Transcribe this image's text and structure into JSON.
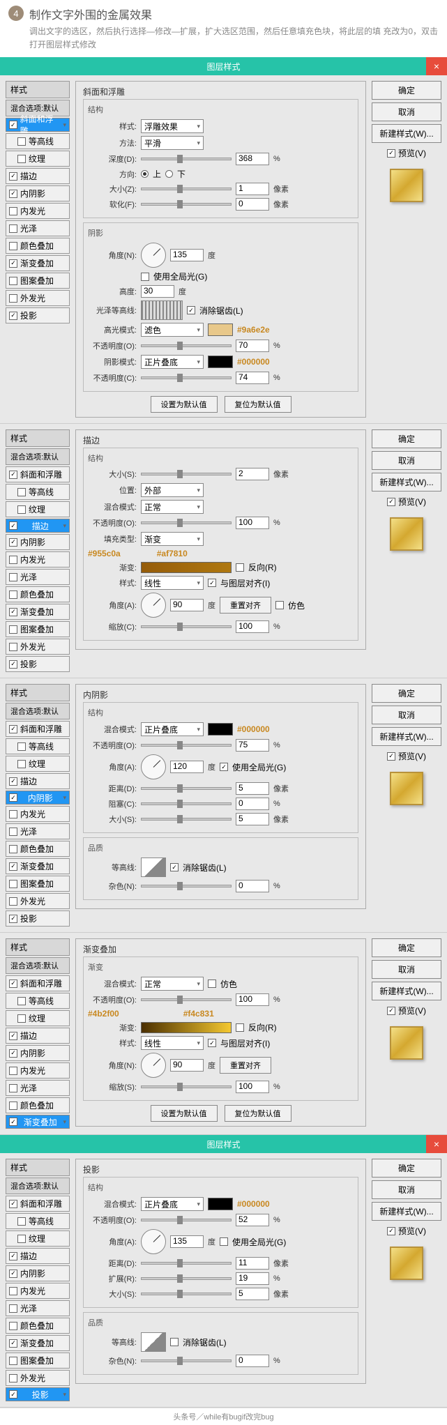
{
  "header": {
    "step": "4",
    "title": "制作文字外围的金属效果",
    "desc": "调出文字的选区，然后执行选择—修改—扩展，扩大选区范围，然后任意填充色块，将此层的填 充改为0，双击打开图层样式修改"
  },
  "titlebar": "图层样式",
  "close": "×",
  "stylesHeader": "样式",
  "blendDefault": "混合选项:默认",
  "styleNames": {
    "bevel": "斜面和浮雕",
    "contour": "等高线",
    "texture": "纹理",
    "stroke": "描边",
    "innerShadow": "内阴影",
    "innerGlow": "内发光",
    "satin": "光泽",
    "colorOverlay": "颜色叠加",
    "gradOverlay": "渐变叠加",
    "pattOverlay": "图案叠加",
    "outerGlow": "外发光",
    "dropShadow": "投影"
  },
  "rightBtns": {
    "ok": "确定",
    "cancel": "取消",
    "newStyle": "新建样式(W)...",
    "preview": "预览(V)"
  },
  "labels": {
    "structure": "结构",
    "style": "样式:",
    "technique": "方法:",
    "depth": "深度(D):",
    "direction": "方向:",
    "up": "上",
    "down": "下",
    "size": "大小(Z):",
    "soften": "软化(F):",
    "shading": "阴影",
    "angle": "角度(N):",
    "altitude": "高度:",
    "glossContour": "光泽等高线:",
    "antiAlias": "消除锯齿(L)",
    "highlight": "高光模式:",
    "opacity": "不透明度(O):",
    "shadowMode": "阴影模式:",
    "opacityC": "不透明度(C):",
    "useGlobal": "使用全局光(G)",
    "setDefault": "设置为默认值",
    "resetDefault": "复位为默认值",
    "px": "像素",
    "pct": "%",
    "deg": "度",
    "sizeS": "大小(S):",
    "position": "位置:",
    "blendMode": "混合模式:",
    "fillType": "填充类型:",
    "gradient": "渐变:",
    "reverse": "反向(R)",
    "alignLayer": "与图层对齐(I)",
    "angleA": "角度(A):",
    "scale": "缩放(C):",
    "scaleS": "缩放(S):",
    "resetAlign": "重置对齐",
    "dither": "仿色",
    "distance": "距离(D):",
    "choke": "阻塞(C):",
    "quality": "品质",
    "contourLbl": "等高线:",
    "noise": "杂色(N):",
    "spread": "扩展(R):"
  },
  "bevel": {
    "title": "斜面和浮雕",
    "style": "浮雕效果",
    "technique": "平滑",
    "depth": "368",
    "size": "1",
    "soften": "0",
    "angle": "135",
    "altitude": "30",
    "highlightMode": "滤色",
    "highlightHex": "#9a6e2e",
    "highlightOpacity": "70",
    "shadowMode": "正片叠底",
    "shadowHex": "#000000",
    "shadowOpacity": "74"
  },
  "stroke": {
    "title": "描边",
    "size": "2",
    "position": "外部",
    "blendMode": "正常",
    "opacity": "100",
    "fillType": "渐变",
    "hex1": "#955c0a",
    "hex2": "#af7810",
    "style": "线性",
    "angle": "90",
    "scale": "100"
  },
  "innerShadow": {
    "title": "内阴影",
    "blendMode": "正片叠底",
    "hex": "#000000",
    "opacity": "75",
    "angle": "120",
    "distance": "5",
    "choke": "0",
    "size": "5",
    "noise": "0"
  },
  "gradOverlay": {
    "title": "渐变叠加",
    "sub": "渐变",
    "blendMode": "正常",
    "opacity": "100",
    "hex1": "#4b2f00",
    "hex2": "#f4c831",
    "style": "线性",
    "angle": "90",
    "scale": "100"
  },
  "dropShadow": {
    "title": "投影",
    "blendMode": "正片叠底",
    "hex": "#000000",
    "opacity": "52",
    "angle": "135",
    "distance": "11",
    "spread": "19",
    "size": "5",
    "noise": "0"
  },
  "footer": "头条号／while有bugif改完bug"
}
